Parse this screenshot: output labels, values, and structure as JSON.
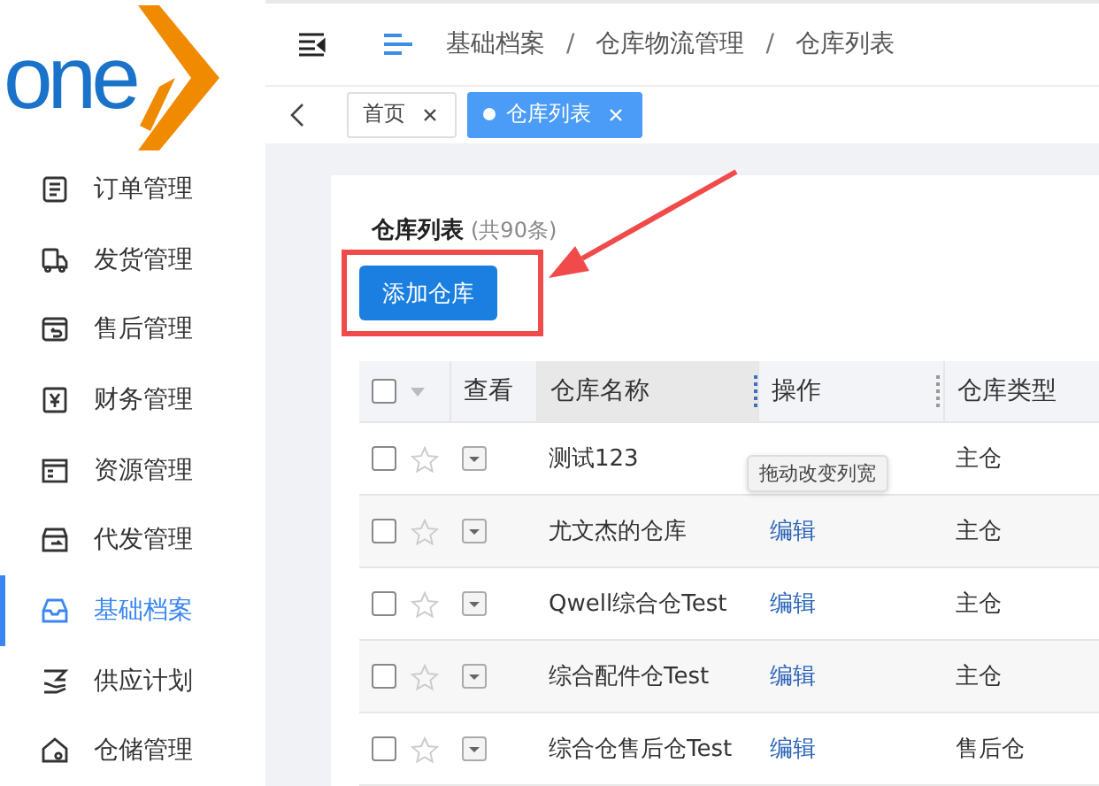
{
  "logo": {
    "text": "one"
  },
  "sidebar": {
    "items": [
      {
        "label": "订单管理",
        "selected": false
      },
      {
        "label": "发货管理",
        "selected": false
      },
      {
        "label": "售后管理",
        "selected": false
      },
      {
        "label": "财务管理",
        "selected": false
      },
      {
        "label": "资源管理",
        "selected": false
      },
      {
        "label": "代发管理",
        "selected": false
      },
      {
        "label": "基础档案",
        "selected": true
      },
      {
        "label": "供应计划",
        "selected": false
      },
      {
        "label": "仓储管理",
        "selected": false
      }
    ]
  },
  "breadcrumb": [
    "基础档案",
    "仓库物流管理",
    "仓库列表"
  ],
  "breadcrumb_separator": "/",
  "tabs": [
    {
      "label": "首页",
      "selected": false
    },
    {
      "label": "仓库列表",
      "selected": true
    }
  ],
  "card": {
    "title": "仓库列表",
    "count": "(共90条)",
    "add_button": "添加仓库"
  },
  "table": {
    "columns": [
      "查看",
      "仓库名称",
      "操作",
      "仓库类型"
    ],
    "header_checked": false,
    "rows": [
      {
        "name": "测试123",
        "type": "主仓",
        "checked": false,
        "starred": false
      },
      {
        "name": "尤文杰的仓库",
        "op": "编辑",
        "type": "主仓",
        "checked": false,
        "starred": false
      },
      {
        "name": "Qwell综合仓Test",
        "op": "编辑",
        "type": "主仓",
        "checked": false,
        "starred": false
      },
      {
        "name": "综合配件仓Test",
        "op": "编辑",
        "type": "主仓",
        "checked": false,
        "starred": false
      },
      {
        "name": "综合仓售后仓Test",
        "op": "编辑",
        "type": "售后仓",
        "checked": false,
        "starred": false
      }
    ]
  },
  "tooltip": "拖动改变列宽"
}
